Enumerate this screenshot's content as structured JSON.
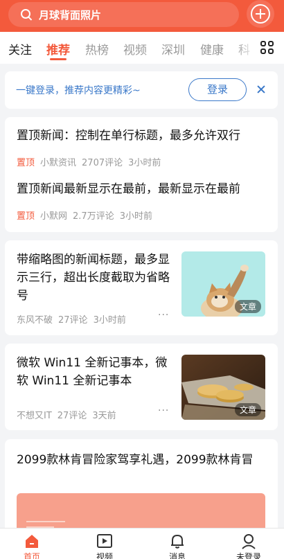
{
  "search": {
    "text": "月球背面照片"
  },
  "tabs": [
    "关注",
    "推荐",
    "热榜",
    "视频",
    "深圳",
    "健康",
    "科"
  ],
  "login_banner": {
    "text": "一键登录，推荐内容更精彩~",
    "button": "登录"
  },
  "pinned": [
    {
      "title": "置顶新闻：控制在单行标题，最多允许双行",
      "badge": "置顶",
      "source": "小默资讯",
      "comments": "2707评论",
      "time": "3小时前"
    },
    {
      "title": "置顶新闻最新显示在最前，最新显示在最前",
      "badge": "置顶",
      "source": "小默网",
      "comments": "2.7万评论",
      "time": "3小时前"
    }
  ],
  "articles": [
    {
      "title": "带缩略图的新闻标题，最多显示三行，超出长度截取为省略号",
      "source": "东风不破",
      "comments": "27评论",
      "time": "3小时前",
      "thumb_label": "文章",
      "thumb_icon": "cat-photo"
    },
    {
      "title": "微软 Win11 全新记事本，微软 Win11 全新记事本",
      "source": "不想又IT",
      "comments": "27评论",
      "time": "3天前",
      "thumb_label": "文章",
      "thumb_icon": "coins-photo"
    },
    {
      "title": "2099款林肯冒险家驾享礼遇，2099款林肯冒"
    }
  ],
  "more_label": "···",
  "bottom_nav": [
    {
      "label": "首页",
      "icon": "home-icon",
      "active": true
    },
    {
      "label": "视频",
      "icon": "play-icon",
      "active": false
    },
    {
      "label": "消息",
      "icon": "bell-icon",
      "active": false
    },
    {
      "label": "未登录",
      "icon": "user-icon",
      "active": false
    }
  ],
  "colors": {
    "accent": "#f35a3c",
    "link": "#3a78c9"
  }
}
